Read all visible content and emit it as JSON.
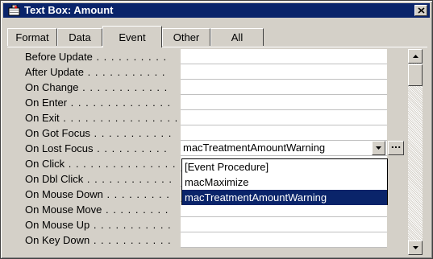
{
  "window": {
    "title": "Text Box: Amount",
    "close_icon": "close-icon"
  },
  "tabs": [
    {
      "label": "Format"
    },
    {
      "label": "Data"
    },
    {
      "label": "Event",
      "active": true
    },
    {
      "label": "Other"
    },
    {
      "label": "All"
    }
  ],
  "properties": [
    {
      "label": "Before Update",
      "value": ""
    },
    {
      "label": "After Update",
      "value": ""
    },
    {
      "label": "On Change",
      "value": ""
    },
    {
      "label": "On Enter",
      "value": ""
    },
    {
      "label": "On Exit",
      "value": ""
    },
    {
      "label": "On Got Focus",
      "value": ""
    },
    {
      "label": "On Lost Focus",
      "value": "macTreatmentAmountWarning"
    },
    {
      "label": "On Click",
      "value": ""
    },
    {
      "label": "On Dbl Click",
      "value": ""
    },
    {
      "label": "On Mouse Down",
      "value": ""
    },
    {
      "label": "On Mouse Move",
      "value": ""
    },
    {
      "label": "On Mouse Up",
      "value": ""
    },
    {
      "label": "On Key Down",
      "value": ""
    }
  ],
  "dropdown": {
    "options": [
      "[Event Procedure]",
      "macMaximize",
      "macTreatmentAmountWarning"
    ],
    "selected": "macTreatmentAmountWarning"
  },
  "build_button": {
    "label": "..."
  }
}
